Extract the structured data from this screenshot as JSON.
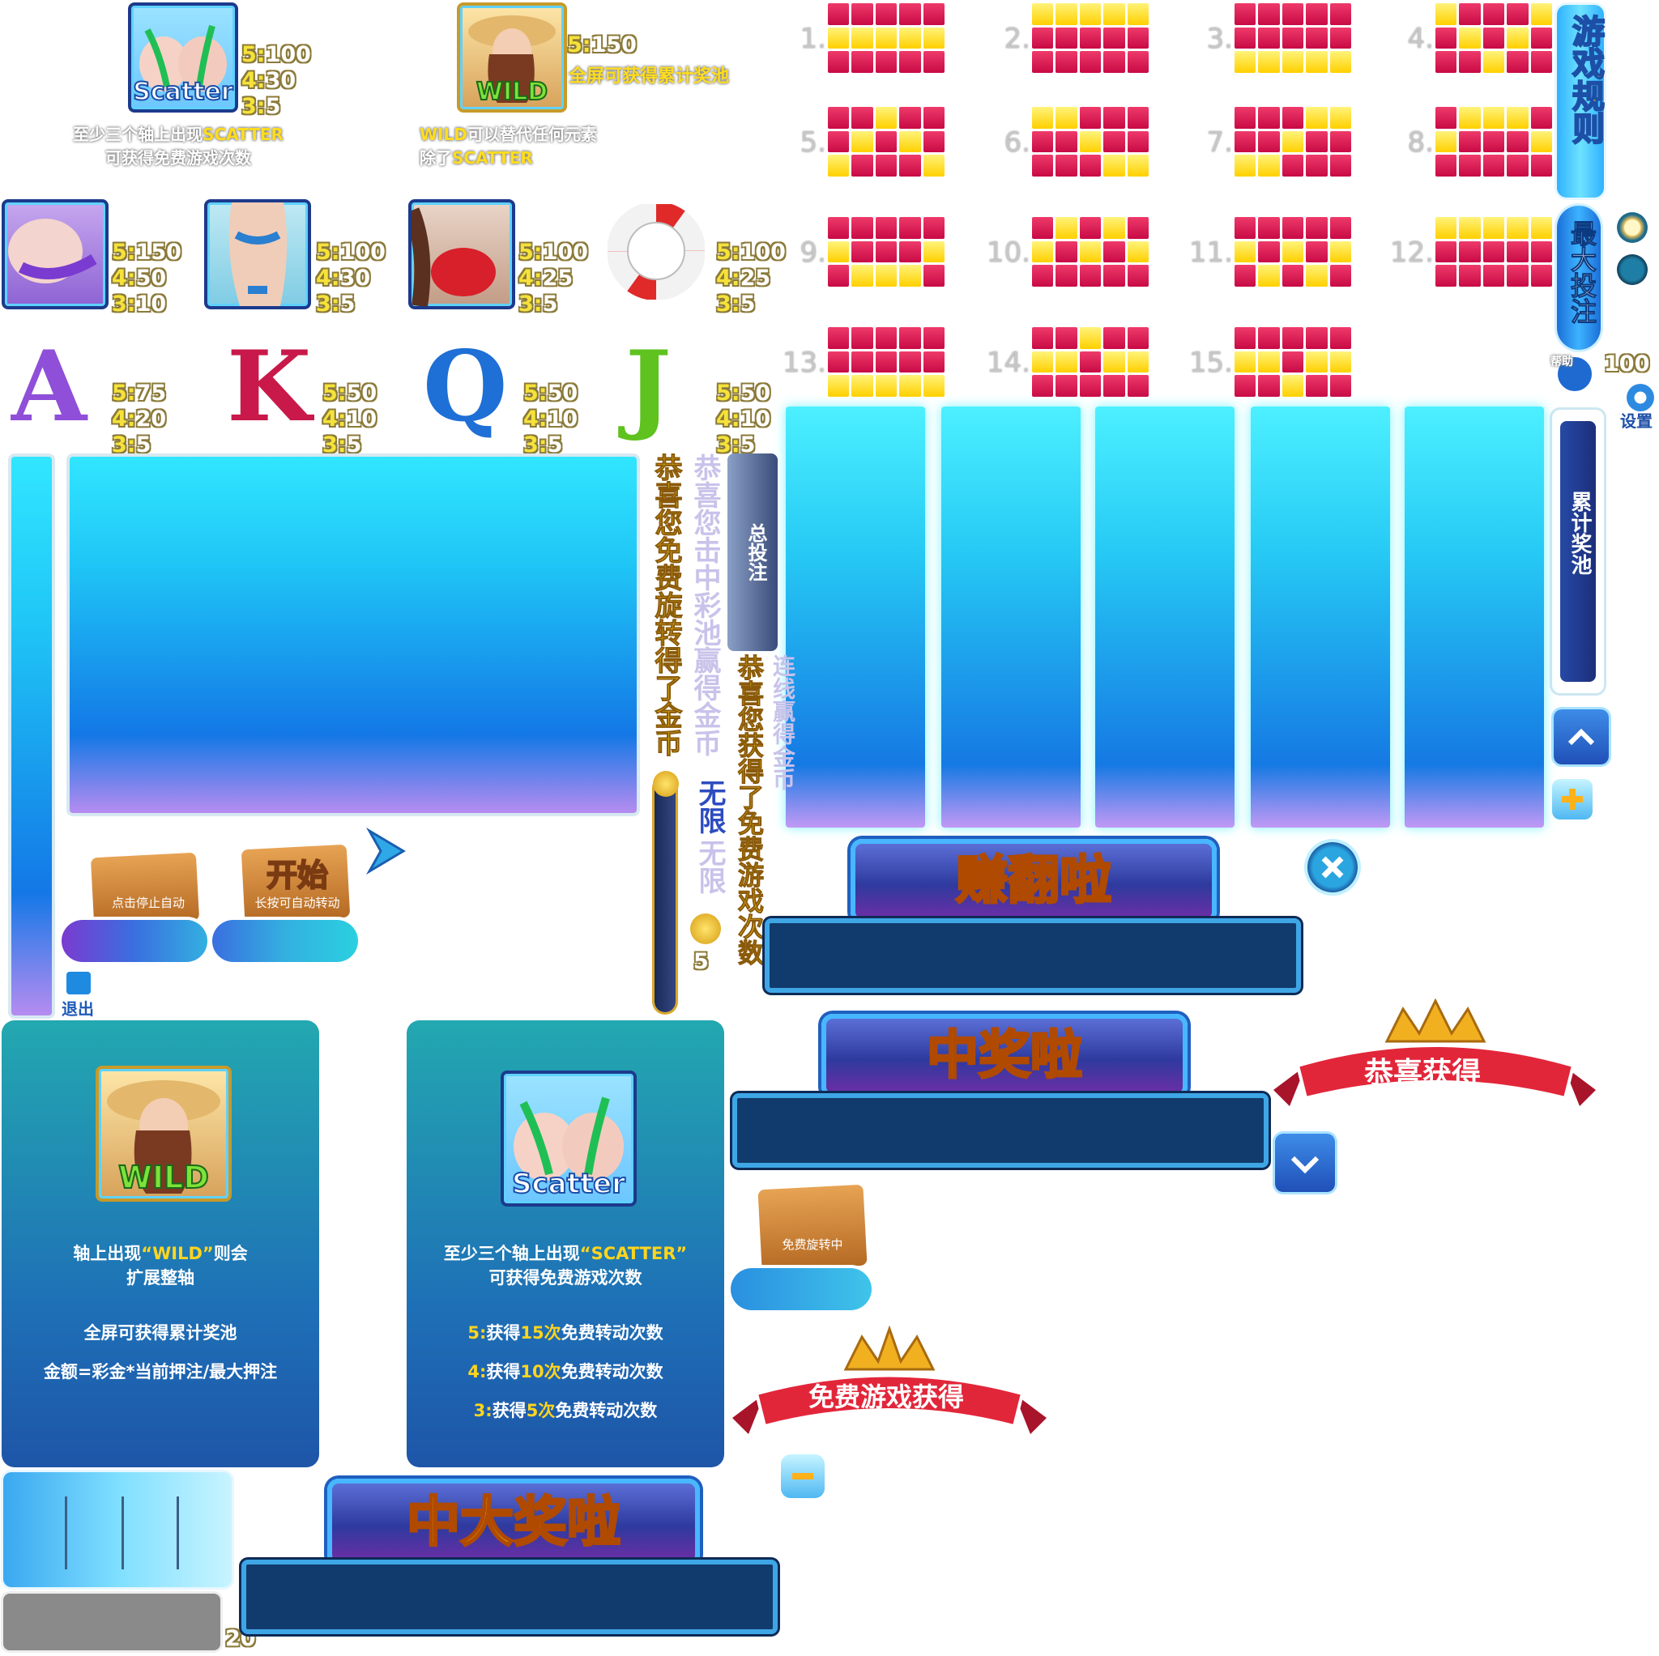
{
  "symbols": {
    "scatter": {
      "label": "Scatter",
      "pays": [
        "5:",
        "100",
        "4:",
        "30",
        "3:",
        "5"
      ],
      "note1a": "至少三个轴上出现",
      "note1b": "SCATTER",
      "note2": "可获得免费游戏次数"
    },
    "wild": {
      "label": "WILD",
      "pay_k": "5:",
      "pay_v": "150",
      "pay_note": "全屏可获得累计奖池",
      "note1a": "WILD",
      "note1b": "可以替代任何元素",
      "note2a": "除了",
      "note2b": "SCATTER"
    },
    "girl1": {
      "pays": [
        "5:",
        "150",
        "4:",
        "50",
        "3:",
        "10"
      ]
    },
    "girl2": {
      "pays": [
        "5:",
        "100",
        "4:",
        "30",
        "3:",
        "5"
      ]
    },
    "girl3": {
      "pays": [
        "5:",
        "100",
        "4:",
        "25",
        "3:",
        "5"
      ]
    },
    "ring": {
      "pays": [
        "5:",
        "100",
        "4:",
        "25",
        "3:",
        "5"
      ]
    },
    "A": {
      "char": "A",
      "pays": [
        "5:",
        "75",
        "4:",
        "20",
        "3:",
        "5"
      ]
    },
    "K": {
      "char": "K",
      "pays": [
        "5:",
        "50",
        "4:",
        "10",
        "3:",
        "5"
      ]
    },
    "Q": {
      "char": "Q",
      "pays": [
        "5:",
        "50",
        "4:",
        "10",
        "3:",
        "5"
      ]
    },
    "J": {
      "char": "J",
      "pays": [
        "5:",
        "50",
        "4:",
        "10",
        "3:",
        "5"
      ]
    }
  },
  "paylines": [
    {
      "num": "1.",
      "pattern": [
        "rrrrr",
        "yyyyy",
        "rrrrr"
      ]
    },
    {
      "num": "2.",
      "pattern": [
        "yyyyy",
        "rrrrr",
        "rrrrr"
      ]
    },
    {
      "num": "3.",
      "pattern": [
        "rrrrr",
        "rrrrr",
        "yyyyy"
      ]
    },
    {
      "num": "4.",
      "pattern": [
        "yrrry",
        "ryryr",
        "rryrr"
      ]
    },
    {
      "num": "5.",
      "pattern": [
        "rryrr",
        "ryryr",
        "yrrry"
      ]
    },
    {
      "num": "6.",
      "pattern": [
        "yyrrr",
        "rryrr",
        "rrryy"
      ]
    },
    {
      "num": "7.",
      "pattern": [
        "rrryy",
        "rryrr",
        "yyrrr"
      ]
    },
    {
      "num": "8.",
      "pattern": [
        "ryyyr",
        "yrrry",
        "rrrrr"
      ]
    },
    {
      "num": "9.",
      "pattern": [
        "rrrrr",
        "yrrry",
        "ryyyr"
      ]
    },
    {
      "num": "10.",
      "pattern": [
        "ryryr",
        "yryry",
        "rrrrr"
      ]
    },
    {
      "num": "11.",
      "pattern": [
        "rrrrr",
        "yryry",
        "ryryr"
      ]
    },
    {
      "num": "12.",
      "pattern": [
        "yyyyy",
        "rrrrr",
        "rrrrr"
      ]
    },
    {
      "num": "13.",
      "pattern": [
        "rrrrr",
        "rrrrr",
        "yyyyy"
      ]
    },
    {
      "num": "14.",
      "pattern": [
        "rryrr",
        "yyryy",
        "rrrrr"
      ]
    },
    {
      "num": "15.",
      "pattern": [
        "rrrrr",
        "yyryy",
        "rryrr"
      ]
    }
  ],
  "side": {
    "rules": "游戏规则",
    "maxbet": "最大投注",
    "help": "帮助",
    "bet_value": "100",
    "settings": "设置",
    "jackpot": "累计奖池",
    "exit": "退出"
  },
  "buttons": {
    "stop_auto": "点击停止自动",
    "start": "开始",
    "start_hint": "长按可自动转动",
    "freespin": "免费旋转中"
  },
  "vertical": {
    "t1": "恭喜您免费旋转得了金币",
    "t2": "恭喜您击中彩池赢得金币",
    "t3": "连线赢得金币",
    "t4": "恭喜您获得了免费游戏次数",
    "t5": "无限",
    "t6": "无限",
    "total_bet": "总投注",
    "coin": "5"
  },
  "banners": {
    "win1": "赚翻啦",
    "win2": "中奖啦",
    "win3": "中大奖啦"
  },
  "ribbons": {
    "congrats": "恭喜获得",
    "free": "免费游戏获得"
  },
  "cards": {
    "wild": {
      "label": "WILD",
      "l1": "轴上出现",
      "l1b": "“WILD”",
      "l1c": "则会",
      "l2": "扩展整轴",
      "l3": "全屏可获得累计奖池",
      "l4": "金额=彩金*当前押注/最大押注"
    },
    "scatter": {
      "label": "Scatter",
      "l1": "至少三个轴上出现",
      "l1b": "“SCATTER”",
      "l2": "可获得免费游戏次数",
      "r5a": "5:",
      "r5b": "获得",
      "r5c": "15次",
      "r5d": "免费转动次数",
      "r4a": "4:",
      "r4b": "获得",
      "r4c": "10次",
      "r4d": "免费转动次数",
      "r3a": "3:",
      "r3b": "获得",
      "r3c": "5次",
      "r3d": "免费转动次数"
    }
  },
  "bottom": {
    "counter": "20"
  },
  "colors": {
    "red": "#d0104c",
    "yellow": "#ffd21e",
    "cyan": "#2fe4ff",
    "navy": "#113b6c"
  }
}
